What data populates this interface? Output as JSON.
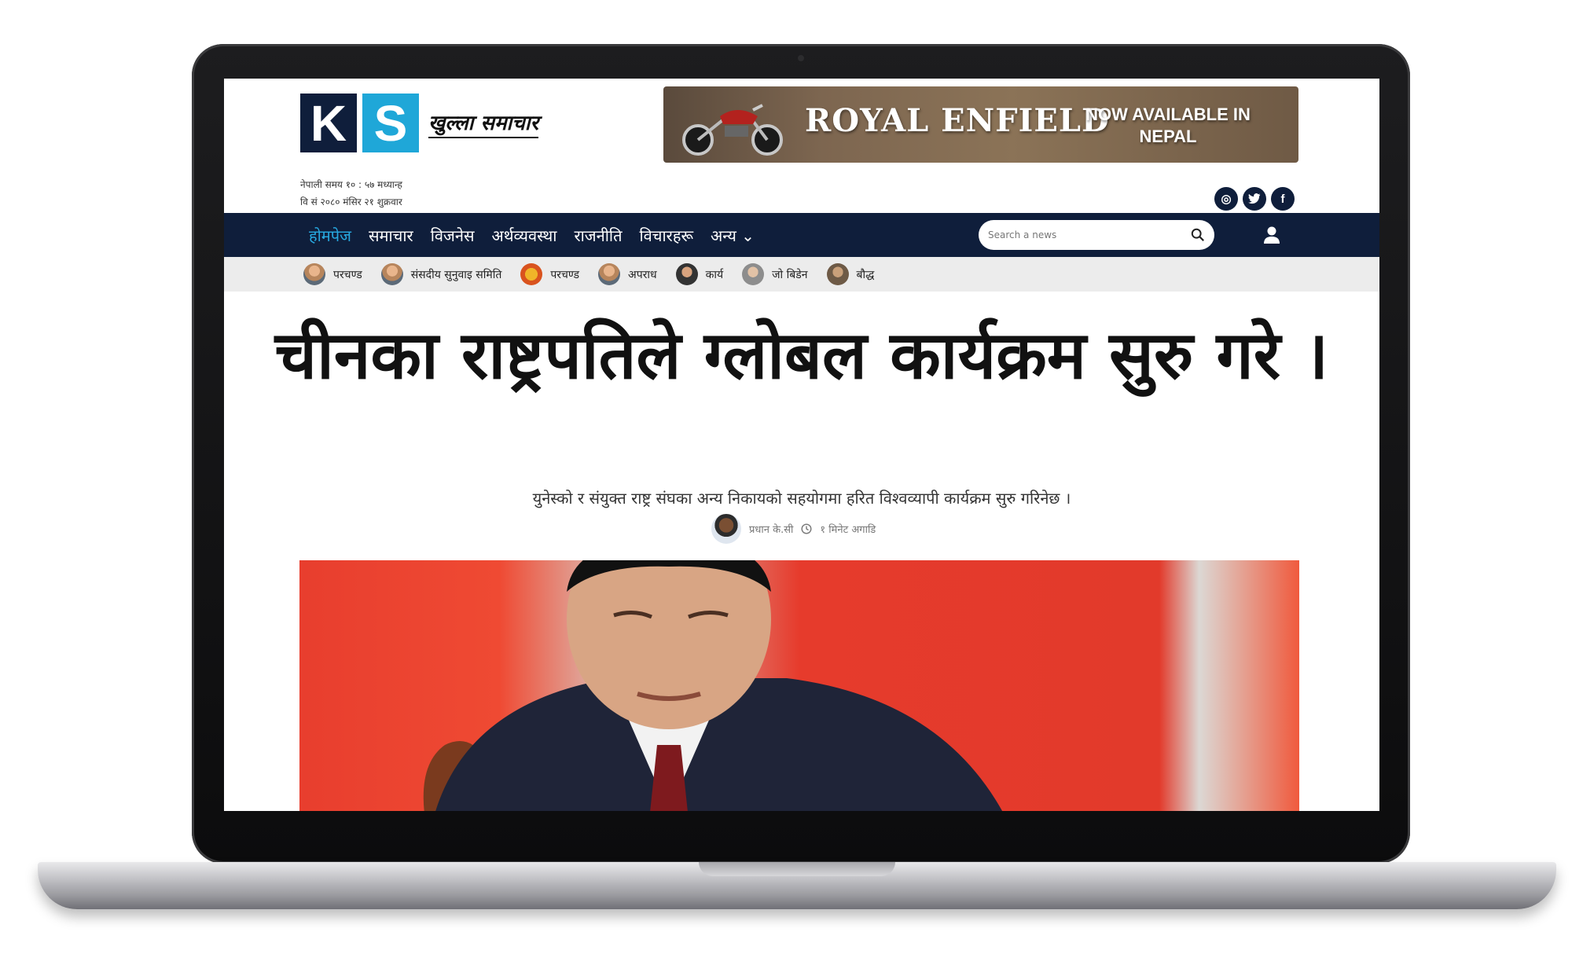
{
  "logo": {
    "k": "K",
    "s": "S",
    "name": "खुल्ला समाचार"
  },
  "ad": {
    "brand": "ROYAL ENFIELD",
    "tagline": "NOW AVAILABLE IN NEPAL"
  },
  "time": {
    "nepali_time": "नेपाली समय १० : ५७ मध्यान्ह",
    "date": "वि सं २०८० मंसिर २१ शुक्रवार"
  },
  "social": [
    {
      "icon": "instagram-icon",
      "glyph": "◎"
    },
    {
      "icon": "twitter-icon",
      "glyph": "🐦"
    },
    {
      "icon": "facebook-icon",
      "glyph": "f"
    }
  ],
  "nav": {
    "items": [
      "होमपेज",
      "समाचार",
      "विजनेस",
      "अर्थव्यवस्था",
      "राजनीति",
      "विचारहरू",
      "अन्य"
    ],
    "active_index": 0,
    "search_placeholder": "Search a news",
    "accent": "#27a9e1",
    "bg": "#0f1e3b"
  },
  "tags": [
    "परचण्ड",
    "संसदीय सुनुवाइ समिति",
    "परचण्ड",
    "अपराध",
    "कार्य",
    "जो बिडेन",
    "बौद्ध"
  ],
  "article": {
    "headline": "चीनका राष्ट्रपतिले ग्लोबल कार्यक्रम सुरु गरे ।",
    "subtitle": "युनेस्को र संयुक्त राष्ट्र संघका अन्य निकायको सहयोगमा हरित विश्वव्यापी कार्यक्रम सुरु गरिनेछ ।",
    "author": "प्रधान के.सी",
    "time_ago": "१ मिनेट अगाडि"
  }
}
